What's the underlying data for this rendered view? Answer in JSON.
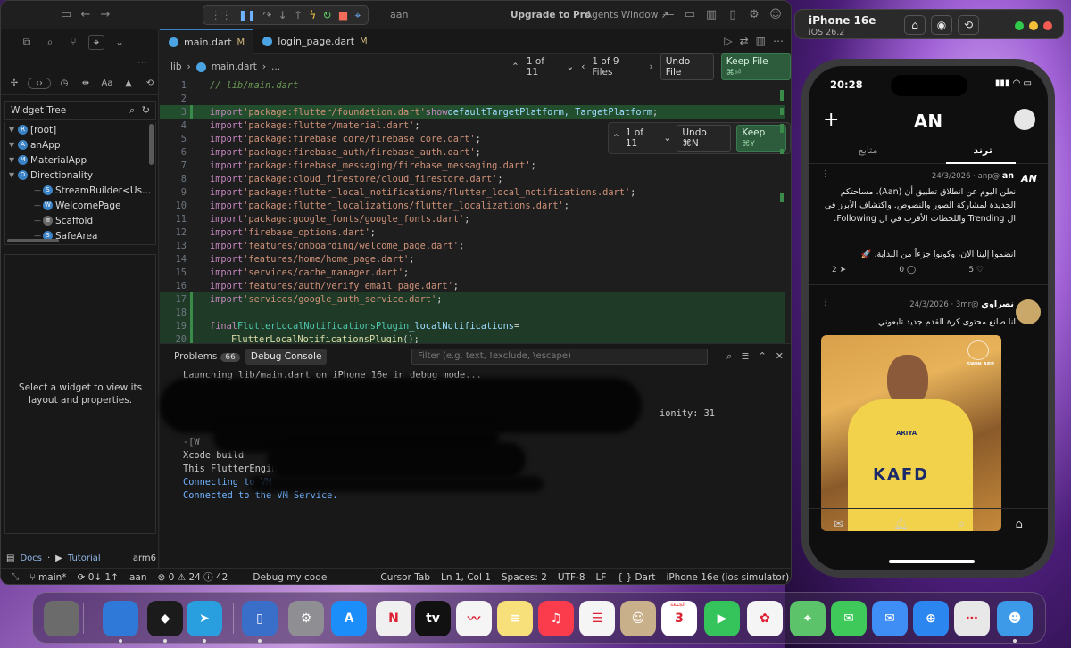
{
  "titlebar": {
    "project": "aan",
    "upgrade": "Upgrade to Pro",
    "agents_window": "Agents Window",
    "agents_arrow": "↗"
  },
  "left_panel": {
    "widget_tree_title": "Widget Tree",
    "tree": [
      {
        "label": "[root]",
        "badge": "R",
        "indent": 0
      },
      {
        "label": "anApp",
        "badge": "A",
        "indent": 0
      },
      {
        "label": "MaterialApp",
        "badge": "M",
        "indent": 0
      },
      {
        "label": "Directionality",
        "badge": "D",
        "indent": 0
      },
      {
        "label": "StreamBuilder<Us...",
        "badge": "S",
        "indent": 1
      },
      {
        "label": "WelcomePage",
        "badge": "W",
        "indent": 1
      },
      {
        "label": "Scaffold",
        "badge": "≡",
        "indent": 1
      },
      {
        "label": "SafeArea",
        "badge": "S",
        "indent": 1
      }
    ],
    "detail_message": "Select a widget to view its layout and properties.",
    "docs": "Docs",
    "tutorial": "Tutorial",
    "arch": "arm6"
  },
  "tabs": [
    {
      "name": "main.dart",
      "mod": "M"
    },
    {
      "name": "login_page.dart",
      "mod": "M"
    }
  ],
  "breadcrumb": {
    "folder": "lib",
    "file": "main.dart",
    "more": "..."
  },
  "changes": {
    "hunk_counter": "1 of 11",
    "file_counter": "1 of 9 Files",
    "undo_file": "Undo File",
    "keep_file": "Keep File",
    "keep_file_key": "⌘⏎",
    "inline_counter": "1 of 11",
    "inline_undo": "Undo ⌘N",
    "inline_keep": "Keep",
    "inline_keep_key": "⌘Y"
  },
  "code_lines": [
    "1",
    "2",
    "3",
    "4",
    "5",
    "6",
    "7",
    "8",
    "9",
    "10",
    "11",
    "12",
    "13",
    "14",
    "15",
    "16",
    "17",
    "18",
    "19",
    "20"
  ],
  "code": {
    "l1": "// lib/main.dart",
    "l3_a": "import ",
    "l3_b": "'package:flutter/foundation.dart'",
    "l3_c": " show ",
    "l3_d": "defaultTargetPlatform, TargetPlatform",
    "l3_e": ";",
    "imports": [
      "'package:flutter/material.dart'",
      "'package:firebase_core/firebase_core.dart'",
      "'package:firebase_auth/firebase_auth.dart'",
      "'package:firebase_messaging/firebase_messaging.dart'",
      "'package:cloud_firestore/cloud_firestore.dart'",
      "'package:flutter_local_notifications/flutter_local_notifications.dart'",
      "'package:flutter_localizations/flutter_localizations.dart'",
      "'package:google_fonts/google_fonts.dart'",
      "'firebase_options.dart'",
      "'features/onboarding/welcome_page.dart'",
      "'features/home/home_page.dart'",
      "'services/cache_manager.dart'",
      "'features/auth/verify_email_page.dart'",
      "'services/google_auth_service.dart'"
    ],
    "import_kw": "import ",
    "semi": ";",
    "l19_kw": "final ",
    "l19_type": "FlutterLocalNotificationsPlugin",
    "l19_var": " _localNotifications",
    "l19_eq": " =",
    "l20_fn": "FlutterLocalNotificationsPlugin",
    "l20_end": "();"
  },
  "panel": {
    "problems": "Problems",
    "problems_count": "66",
    "debug_console": "Debug Console",
    "filter_placeholder": "Filter (e.g. text, !exclude, \\escape)",
    "console": [
      "Launching lib/main.dart on iPhone 16e in debug mode...",
      "-[D",
      "-[D",
      "-[W",
      "Xcode build",
      "This FlutterEngine",
      "Connecting to VM",
      "Connected to the VM Service."
    ],
    "console_tail": "ionity: 31"
  },
  "statusbar": {
    "branch": "main*",
    "sync": "0↓ 1↑",
    "project": "aan",
    "errors": "0",
    "warnings": "24",
    "infos": "42",
    "debug": "Debug my code",
    "cursor_tab": "Cursor Tab",
    "position": "Ln 1, Col 1",
    "spaces": "Spaces: 2",
    "encoding": "UTF-8",
    "eol": "LF",
    "language": "Dart",
    "device": "iPhone 16e (ios simulator)"
  },
  "simulator": {
    "device": "iPhone 16e",
    "os": "iOS 26.2"
  },
  "phone": {
    "time": "20:28",
    "app_title": "AN",
    "tab_following": "متابع",
    "tab_trending": "ترند",
    "post1": {
      "name": "an",
      "handle": "anp",
      "date": "24/3/2026",
      "avatar": "AN",
      "text": "نعلن اليوم عن انطلاق تطبيق أن (Aan)، مساحتكم الجديدة لمشاركة الصور والنصوص. واكتشاف الأبرز في ال Trending واللحظات الأقرب في ال Following.",
      "text2": "انضموا إلينا الآن، وكونوا جزءاً من البداية. 🚀",
      "likes": "5",
      "comments": "0",
      "shares": "2"
    },
    "post2": {
      "name": "نصراوي",
      "handle": "3mr",
      "date": "24/3/2026",
      "text": "انا صانع محتوى كرة القدم جديد تابعوني",
      "image_brand": "SWIN APP",
      "jersey": "KAFD",
      "sponsor": "ARIYA"
    }
  },
  "dock": {
    "apps": [
      {
        "name": "trash",
        "color": "#6b6b6b",
        "glyph": ""
      },
      {
        "name": "finder-stack",
        "color": "#2f7ad8",
        "glyph": ""
      },
      {
        "name": "cursor",
        "color": "#1b1b1b",
        "glyph": "◆"
      },
      {
        "name": "telegram",
        "color": "#2a9fe0",
        "glyph": "➤"
      },
      {
        "name": "simulator",
        "color": "#3a6fc9",
        "glyph": "▯"
      },
      {
        "name": "settings",
        "color": "#8e8e93",
        "glyph": "⚙"
      },
      {
        "name": "app-store",
        "color": "#1c8ef9",
        "glyph": "A"
      },
      {
        "name": "news",
        "color": "#f0f0f0",
        "glyph": "N"
      },
      {
        "name": "apple-tv",
        "color": "#111111",
        "glyph": "tv"
      },
      {
        "name": "freeform",
        "color": "#f5f5f5",
        "glyph": "〰"
      },
      {
        "name": "notes",
        "color": "#f7e07a",
        "glyph": "≡"
      },
      {
        "name": "music",
        "color": "#fa3c4c",
        "glyph": "♫"
      },
      {
        "name": "reminders",
        "color": "#f5f5f5",
        "glyph": "☰"
      },
      {
        "name": "contacts",
        "color": "#c8b08a",
        "glyph": "☺"
      },
      {
        "name": "calendar",
        "color": "#ffffff",
        "glyph": "3"
      },
      {
        "name": "facetime",
        "color": "#35c35b",
        "glyph": "▶"
      },
      {
        "name": "photos",
        "color": "#f5f5f5",
        "glyph": "✿"
      },
      {
        "name": "maps",
        "color": "#5cc36a",
        "glyph": "⌖"
      },
      {
        "name": "messages",
        "color": "#3ec95a",
        "glyph": "✉"
      },
      {
        "name": "mail",
        "color": "#3e8ef5",
        "glyph": "✉"
      },
      {
        "name": "safari",
        "color": "#2b86f0",
        "glyph": "⊕"
      },
      {
        "name": "launchpad",
        "color": "#e8e8e8",
        "glyph": "⋯"
      },
      {
        "name": "finder",
        "color": "#3d9ae8",
        "glyph": "☻"
      }
    ],
    "calendar_day_label": "الجمعة"
  },
  "colors": {
    "accent": "#3b82c4",
    "added_bg": "#1f3a26",
    "keep_green": "#2c5c3c"
  }
}
